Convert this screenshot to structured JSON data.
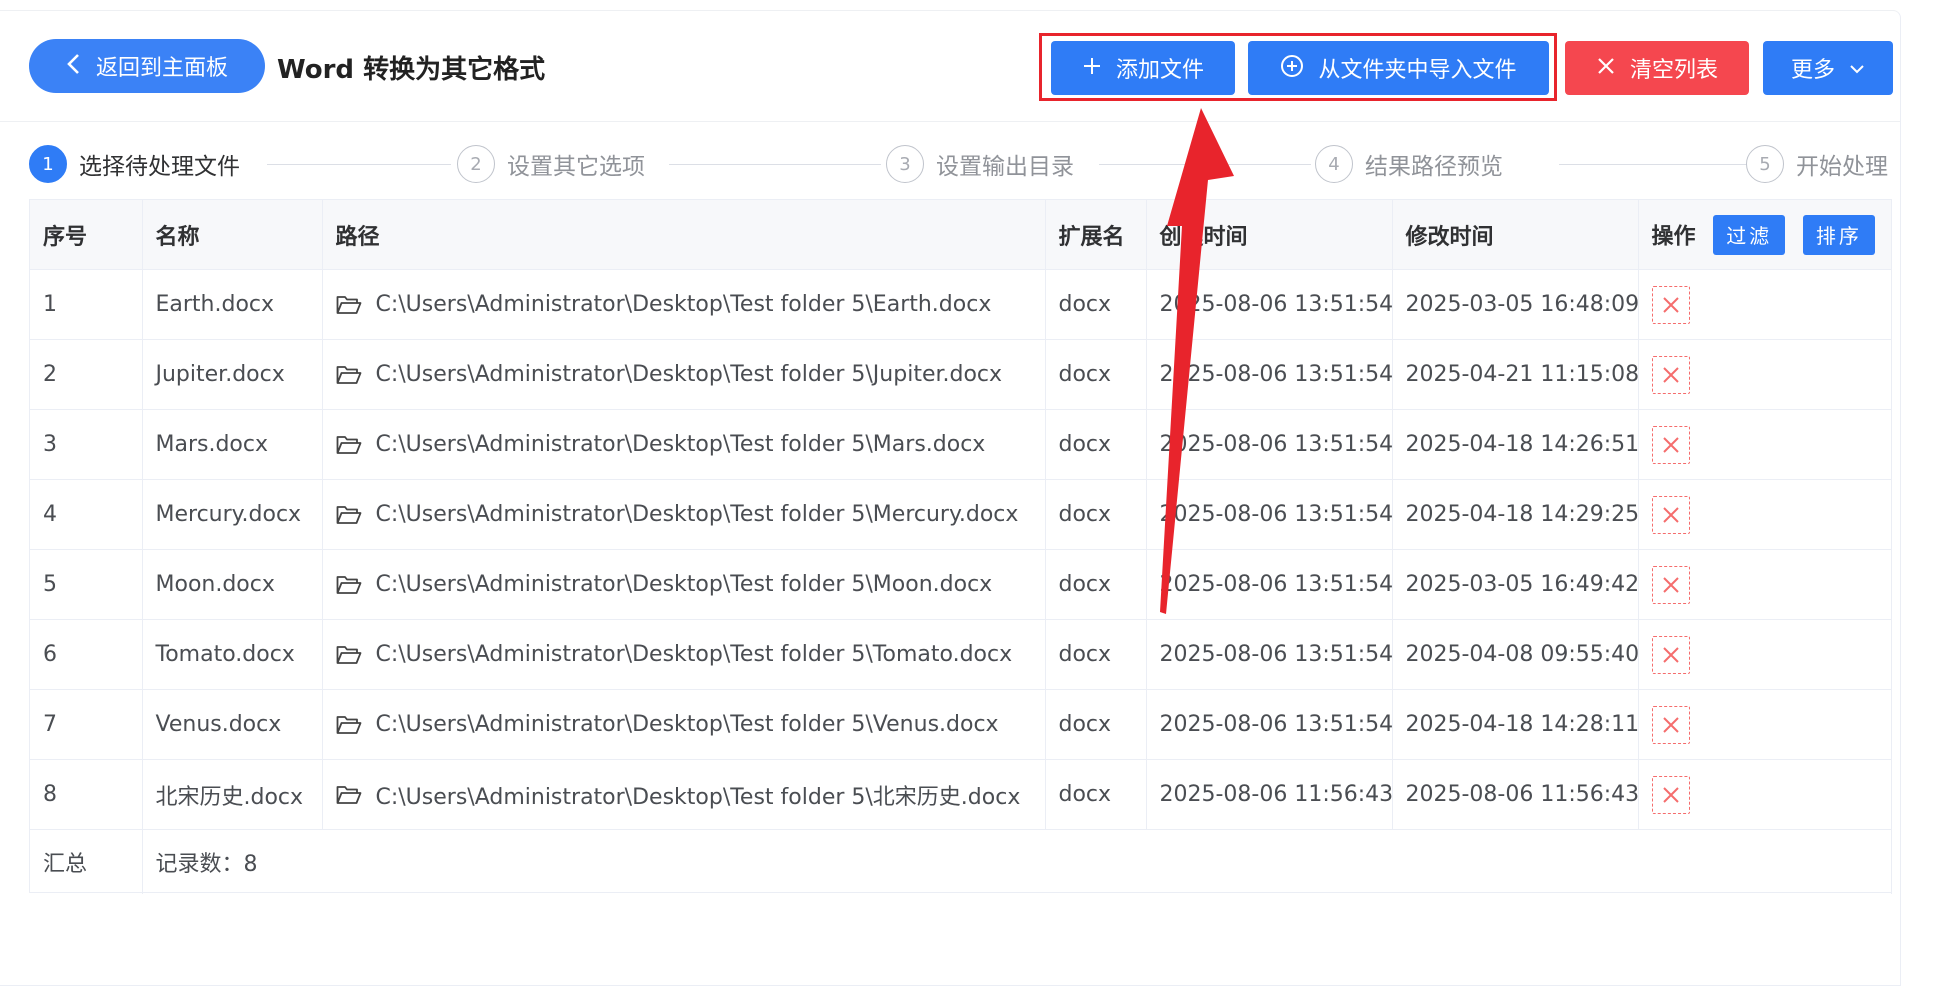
{
  "header": {
    "back_label": "返回到主面板",
    "title": "Word 转换为其它格式",
    "add_file_label": "添加文件",
    "import_folder_label": "从文件夹中导入文件",
    "clear_list_label": "清空列表",
    "more_label": "更多"
  },
  "steps": [
    {
      "num": "1",
      "label": "选择待处理文件"
    },
    {
      "num": "2",
      "label": "设置其它选项"
    },
    {
      "num": "3",
      "label": "设置输出目录"
    },
    {
      "num": "4",
      "label": "结果路径预览"
    },
    {
      "num": "5",
      "label": "开始处理"
    }
  ],
  "table": {
    "columns": {
      "index": "序号",
      "name": "名称",
      "path": "路径",
      "ext": "扩展名",
      "created": "创建时间",
      "modified": "修改时间",
      "action": "操作"
    },
    "filter_label": "过滤",
    "sort_label": "排序",
    "rows": [
      {
        "index": "1",
        "name": "Earth.docx",
        "path": "C:\\Users\\Administrator\\Desktop\\Test folder 5\\Earth.docx",
        "ext": "docx",
        "created": "2025-08-06 13:51:54",
        "modified": "2025-03-05 16:48:09"
      },
      {
        "index": "2",
        "name": "Jupiter.docx",
        "path": "C:\\Users\\Administrator\\Desktop\\Test folder 5\\Jupiter.docx",
        "ext": "docx",
        "created": "2025-08-06 13:51:54",
        "modified": "2025-04-21 11:15:08"
      },
      {
        "index": "3",
        "name": "Mars.docx",
        "path": "C:\\Users\\Administrator\\Desktop\\Test folder 5\\Mars.docx",
        "ext": "docx",
        "created": "2025-08-06 13:51:54",
        "modified": "2025-04-18 14:26:51"
      },
      {
        "index": "4",
        "name": "Mercury.docx",
        "path": "C:\\Users\\Administrator\\Desktop\\Test folder 5\\Mercury.docx",
        "ext": "docx",
        "created": "2025-08-06 13:51:54",
        "modified": "2025-04-18 14:29:25"
      },
      {
        "index": "5",
        "name": "Moon.docx",
        "path": "C:\\Users\\Administrator\\Desktop\\Test folder 5\\Moon.docx",
        "ext": "docx",
        "created": "2025-08-06 13:51:54",
        "modified": "2025-03-05 16:49:42"
      },
      {
        "index": "6",
        "name": "Tomato.docx",
        "path": "C:\\Users\\Administrator\\Desktop\\Test folder 5\\Tomato.docx",
        "ext": "docx",
        "created": "2025-08-06 13:51:54",
        "modified": "2025-04-08 09:55:40"
      },
      {
        "index": "7",
        "name": "Venus.docx",
        "path": "C:\\Users\\Administrator\\Desktop\\Test folder 5\\Venus.docx",
        "ext": "docx",
        "created": "2025-08-06 13:51:54",
        "modified": "2025-04-18 14:28:11"
      },
      {
        "index": "8",
        "name": "北宋历史.docx",
        "path": "C:\\Users\\Administrator\\Desktop\\Test folder 5\\北宋历史.docx",
        "ext": "docx",
        "created": "2025-08-06 11:56:43",
        "modified": "2025-08-06 11:56:43"
      }
    ],
    "summary_label": "汇总",
    "summary_value": "记录数：8"
  },
  "icons": {
    "back": "chevron-left-icon",
    "add": "plus-icon",
    "import": "plus-circle-icon",
    "clear": "close-icon",
    "more": "chevron-down-icon",
    "folder": "folder-open-icon",
    "delete": "close-icon"
  },
  "colors": {
    "primary": "#2f7cf6",
    "danger": "#f5474f",
    "highlight": "#e8242c"
  }
}
